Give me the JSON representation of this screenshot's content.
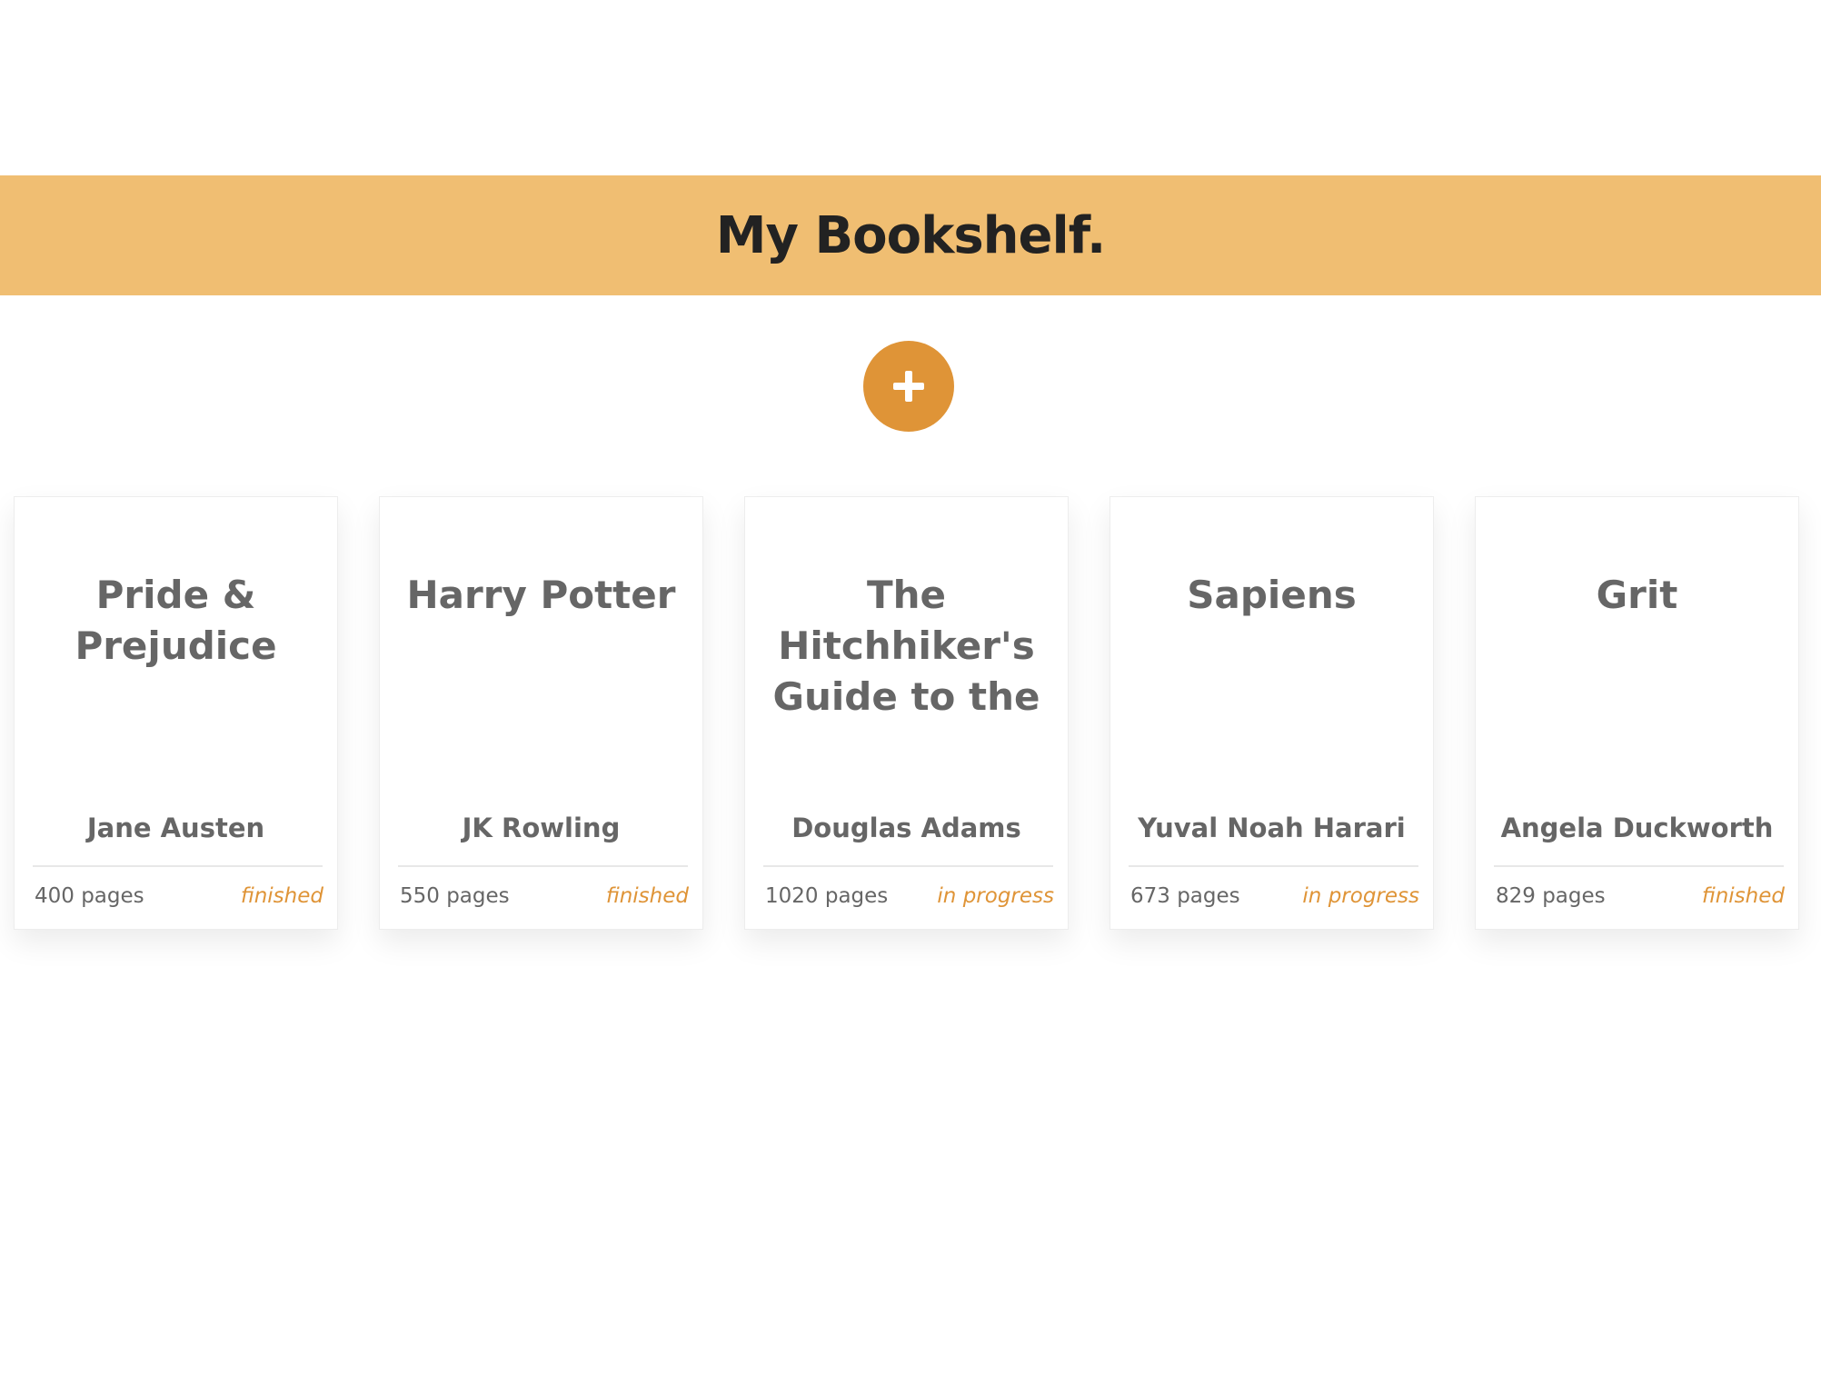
{
  "header": {
    "title": "My Bookshelf."
  },
  "add_button": {
    "icon": "plus-icon"
  },
  "colors": {
    "banner": "#f0be72",
    "accent": "#df9437",
    "text": "#666666",
    "title": "#222222"
  },
  "books": [
    {
      "title": "Pride & Prejudice",
      "author": "Jane Austen",
      "pages": "400 pages",
      "status": "finished"
    },
    {
      "title": "Harry Potter",
      "author": "JK Rowling",
      "pages": "550 pages",
      "status": "finished"
    },
    {
      "title": "The Hitchhiker's Guide to the",
      "author": "Douglas Adams",
      "pages": "1020 pages",
      "status": "in progress"
    },
    {
      "title": "Sapiens",
      "author": "Yuval Noah Harari",
      "pages": "673 pages",
      "status": "in progress"
    },
    {
      "title": "Grit",
      "author": "Angela Duckworth",
      "pages": "829 pages",
      "status": "finished"
    }
  ]
}
